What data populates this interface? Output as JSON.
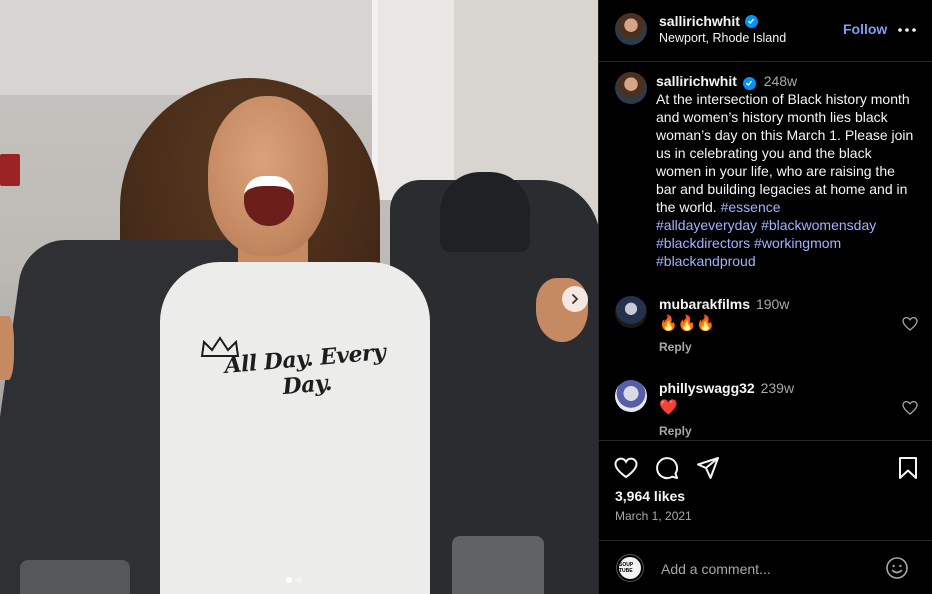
{
  "post": {
    "username": "sallirichwhit",
    "verified": true,
    "location": "Newport, Rhode Island",
    "follow_label": "Follow",
    "image": {
      "shirt_text": "All Day. Every Day.",
      "slide_count": 2,
      "active_slide": 1
    }
  },
  "caption": {
    "username": "sallirichwhit",
    "time": "248w",
    "text": "At the intersection of Black history month and women’s history month lies black woman’s day on this March 1. Please join us in celebrating you and the black women in your life, who are raising the bar and building legacies at home and in the world. ",
    "hashtags": [
      "#essence",
      "#alldayeveryday",
      "#blackwomensday",
      "#blackdirectors",
      "#workingmom",
      "#blackandproud"
    ]
  },
  "comments": [
    {
      "username": "mubarakfilms",
      "time": "190w",
      "text": "🔥🔥🔥",
      "reply_label": "Reply"
    },
    {
      "username": "phillyswagg32",
      "time": "239w",
      "text": "❤️",
      "reply_label": "Reply"
    }
  ],
  "stats": {
    "likes": "3,964 likes",
    "date": "March 1, 2021"
  },
  "add_comment": {
    "placeholder": "Add a comment...",
    "avatar_text": "SOUP TUBE"
  },
  "colors": {
    "background": "#000000",
    "text": "#f5f5f5",
    "secondary_text": "#a8a8a8",
    "link": "#9fb4ff",
    "follow": "#7f9cf5",
    "verified": "#0095f6",
    "divider": "#262626"
  },
  "icons": [
    "verified-badge-icon",
    "more-options-icon",
    "heart-icon",
    "comment-icon",
    "share-icon",
    "bookmark-icon",
    "emoji-icon",
    "chevron-right-icon"
  ]
}
